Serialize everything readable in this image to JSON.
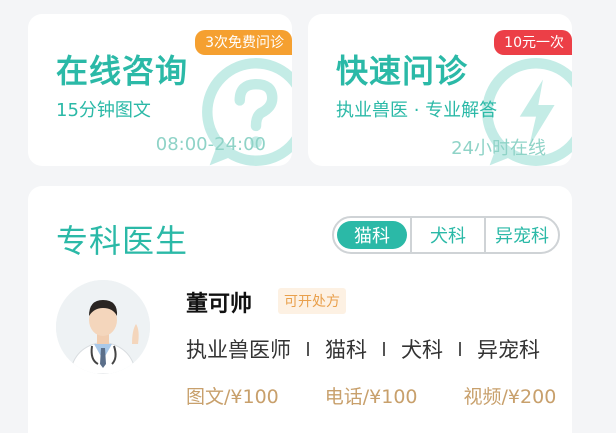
{
  "services": [
    {
      "title": "在线咨询",
      "subtitle": "15分钟图文",
      "footer": "08:00-24:00",
      "badge": "3次免费问诊",
      "badge_color": "#f5a030",
      "watermark_icon": "question-bubble-icon"
    },
    {
      "title": "快速问诊",
      "subtitle": "执业兽医 · 专业解答",
      "footer": "24小时在线",
      "badge": "10元一次",
      "badge_color": "#ec3f47",
      "watermark_icon": "lightning-bubble-icon"
    }
  ],
  "specialists": {
    "title": "专科医生",
    "tabs": [
      "猫科",
      "犬科",
      "异宠科"
    ],
    "active_tab": "猫科",
    "doctor": {
      "name": "董可帅",
      "badge": "可开处方",
      "tags": [
        "执业兽医师",
        "猫科",
        "犬科",
        "异宠科"
      ],
      "prices": [
        "图文/¥100",
        "电话/¥100",
        "视频/¥200"
      ]
    }
  },
  "colors": {
    "accent": "#2bb9a7",
    "price": "#c8a06c"
  }
}
